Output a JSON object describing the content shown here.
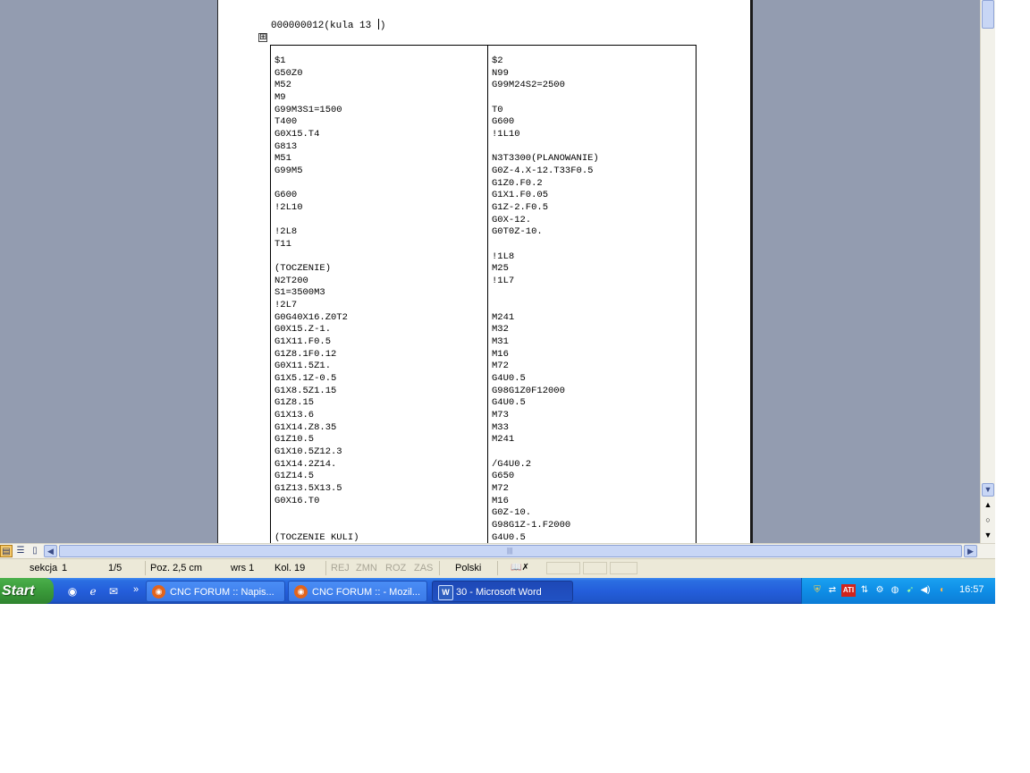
{
  "document": {
    "title_line": "000000012(kula 13 ",
    "title_tail": ")",
    "table": {
      "left_column": [
        "$1",
        "G50Z0",
        "M52",
        "M9",
        "G99M3S1=1500",
        "T400",
        "G0X15.T4",
        "G813",
        "M51",
        "G99M5",
        "",
        "G600",
        "!2L10",
        "",
        "!2L8",
        "T11",
        "",
        "(TOCZENIE)",
        "N2T200",
        "S1=3500M3",
        "!2L7",
        "G0G40X16.Z0T2",
        "G0X15.Z-1.",
        "G1X11.F0.5",
        "G1Z8.1F0.12",
        "G0X11.5Z1.",
        "G1X5.1Z-0.5",
        "G1X8.5Z1.15",
        "G1Z8.15",
        "G1X13.6",
        "G1X14.Z8.35",
        "G1Z10.5",
        "G1X10.5Z12.3",
        "G1X14.2Z14.",
        "G1Z14.5",
        "G1Z13.5X13.5",
        "G0X16.T0",
        "",
        "",
        "(TOCZENIE KULI)"
      ],
      "right_column": [
        "$2",
        "N99",
        "G99M24S2=2500",
        "",
        "T0",
        "G600",
        "!1L10",
        "",
        "N3T3300(PLANOWANIE)",
        "G0Z-4.X-12.T33F0.5",
        "G1Z0.F0.2",
        "G1X1.F0.05",
        "G1Z-2.F0.5",
        "G0X-12.",
        "G0T0Z-10.",
        "",
        "!1L8",
        "M25",
        "!1L7",
        "",
        "",
        "M241",
        "M32",
        "M31",
        "M16",
        "M72",
        "G4U0.5",
        "G98G1Z0F12000",
        "G4U0.5",
        "M73",
        "M33",
        "M241",
        "",
        "/G4U0.2",
        "G650",
        "M72",
        "M16",
        "G0Z-10.",
        "G98G1Z-1.F2000",
        "G4U0.5"
      ]
    }
  },
  "table_handle_glyph": "⊞",
  "scrollbar": {
    "h_grip": "|||"
  },
  "status_bar": {
    "section": "sekcja",
    "section_no": "1",
    "pages": "1/5",
    "position": "Poz. 2,5 cm",
    "line": "wrs 1",
    "column": "Kol. 19",
    "rec": "REJ",
    "track": "ZMN",
    "extend": "ROZ",
    "overtype": "ZAS",
    "language": "Polski",
    "spell_glyph": "📖✗"
  },
  "taskbar": {
    "start_label": "Start",
    "quick_launch": [
      "firefox-icon",
      "ie-icon",
      "outlook-icon"
    ],
    "more_glyph": "»",
    "tasks": [
      {
        "label": "CNC FORUM :: Napis...",
        "icon": "firefox-icon"
      },
      {
        "label": "CNC FORUM :: - Mozil...",
        "icon": "firefox-icon"
      },
      {
        "label": "30 - Microsoft Word",
        "icon": "word-icon"
      }
    ],
    "tray_icons": [
      "shield-icon",
      "network-icon",
      "ati-icon",
      "network-icon",
      "tools-icon",
      "security-icon",
      "arrow-icon",
      "volume-icon",
      "av-icon"
    ],
    "ati_label": "ATI",
    "clock": "16:57"
  },
  "colors": {
    "workspace": "#939cb0",
    "taskbar_blue": "#245edb",
    "start_green": "#3a9a3a",
    "statusbar": "#ece9d8"
  }
}
